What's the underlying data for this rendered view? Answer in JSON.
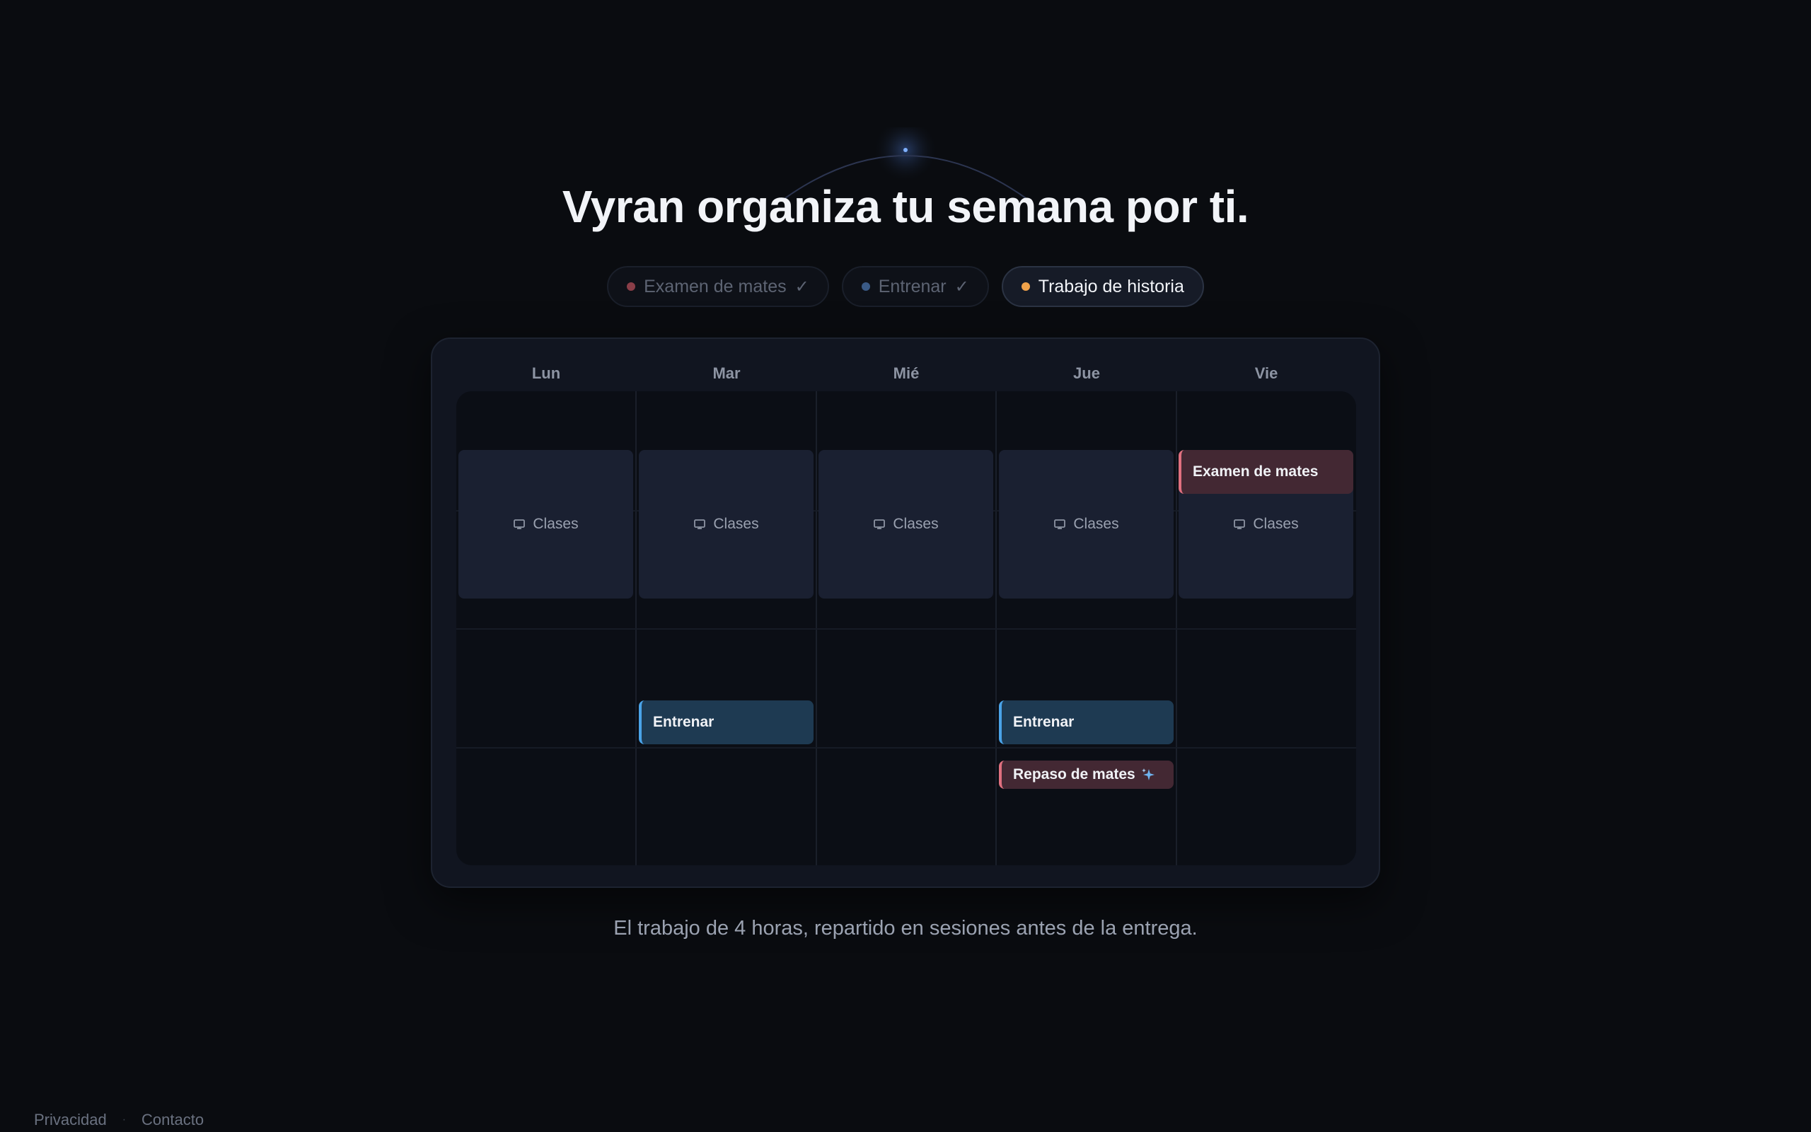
{
  "headline": "Vyran organiza tu semana por ti.",
  "chips": [
    {
      "label": "Examen de mates",
      "check": "✓",
      "dot_color": "#8a3e48",
      "active": false
    },
    {
      "label": "Entrenar",
      "check": "✓",
      "dot_color": "#3a5a86",
      "active": false
    },
    {
      "label": "Trabajo de historia",
      "check": "",
      "dot_color": "#f0a24a",
      "active": true
    }
  ],
  "calendar": {
    "days": [
      "Lun",
      "Mar",
      "Mié",
      "Jue",
      "Vie"
    ],
    "clases_label": "Clases",
    "events": {
      "fri_exam": "Examen de mates",
      "tue_train": "Entrenar",
      "thu_train": "Entrenar",
      "thu_review": "Repaso de mates"
    }
  },
  "caption": "El trabajo de 4 horas, repartido en sesiones antes de la entrega.",
  "footer": {
    "privacy": "Privacidad",
    "separator": "·",
    "contact": "Contacto"
  },
  "colors": {
    "accent_red": "#e0707f",
    "accent_blue": "#4aa3e8",
    "accent_orange": "#f0a24a"
  }
}
